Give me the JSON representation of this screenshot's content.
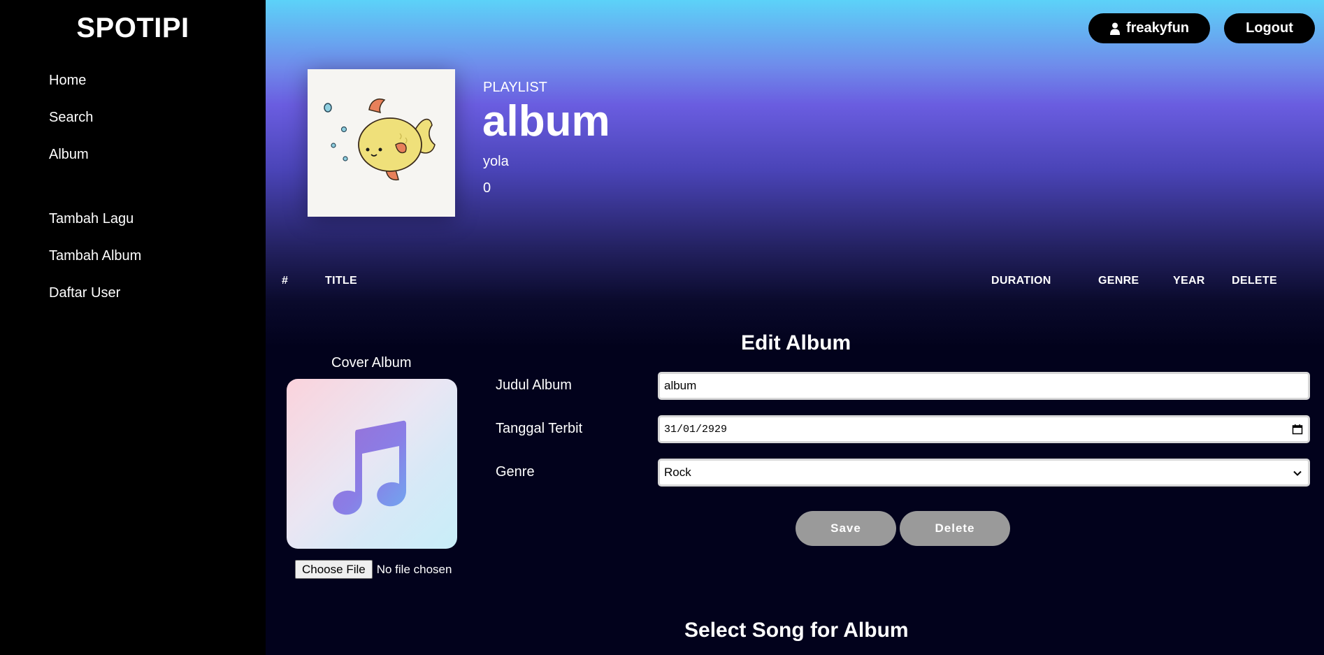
{
  "sidebar": {
    "brand": "SPOTIPI",
    "items": [
      "Home",
      "Search",
      "Album"
    ],
    "admin_items": [
      "Tambah Lagu",
      "Tambah Album",
      "Daftar User"
    ]
  },
  "header": {
    "username": "freakyfun",
    "logout_label": "Logout"
  },
  "playlist": {
    "type_label": "PLAYLIST",
    "title": "album",
    "owner": "yola",
    "song_count": "0"
  },
  "table": {
    "columns": [
      "#",
      "TITLE",
      "DURATION",
      "GENRE",
      "YEAR",
      "DELETE"
    ]
  },
  "edit_form": {
    "heading": "Edit Album",
    "cover_label": "Cover Album",
    "file_button": "Choose File",
    "file_status": "No file chosen",
    "fields": {
      "title_label": "Judul Album",
      "title_value": "album",
      "date_label": "Tanggal Terbit",
      "date_value": "31/01/2929",
      "genre_label": "Genre",
      "genre_value": "Rock"
    },
    "save_label": "Save",
    "delete_label": "Delete"
  },
  "select_song": {
    "heading": "Select Song for Album"
  },
  "icons": {
    "user": "user-icon",
    "calendar": "calendar-icon",
    "chevron": "chevron-down-icon",
    "music": "music-note-icon",
    "cover": "fish-cover-image"
  },
  "colors": {
    "sidebar_bg": "#000000",
    "page_bg": "#02021c",
    "gradient_top": "#5cd2f8",
    "gradient_mid": "#6a5de0",
    "button_grey": "#9a9a9a"
  }
}
